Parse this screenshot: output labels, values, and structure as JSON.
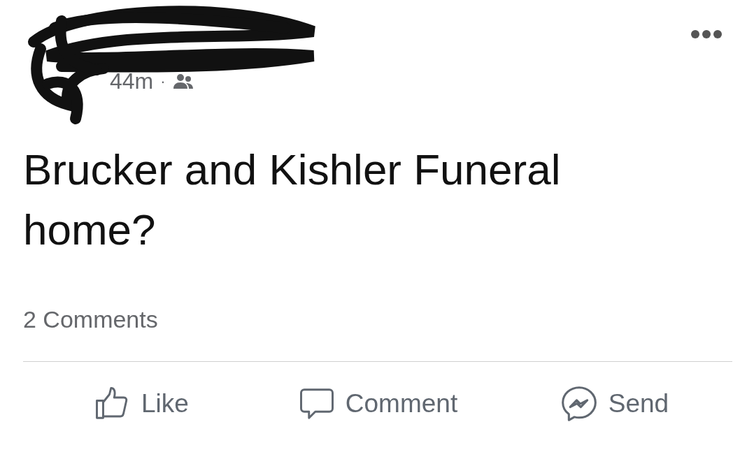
{
  "post": {
    "time": "44m",
    "separator": "·",
    "text": "Brucker and Kishler Funeral home?",
    "comments_count": "2 Comments",
    "actions": [
      {
        "kind": "like",
        "label": "Like"
      },
      {
        "kind": "comment",
        "label": "Comment"
      },
      {
        "kind": "send",
        "label": "Send"
      }
    ]
  }
}
